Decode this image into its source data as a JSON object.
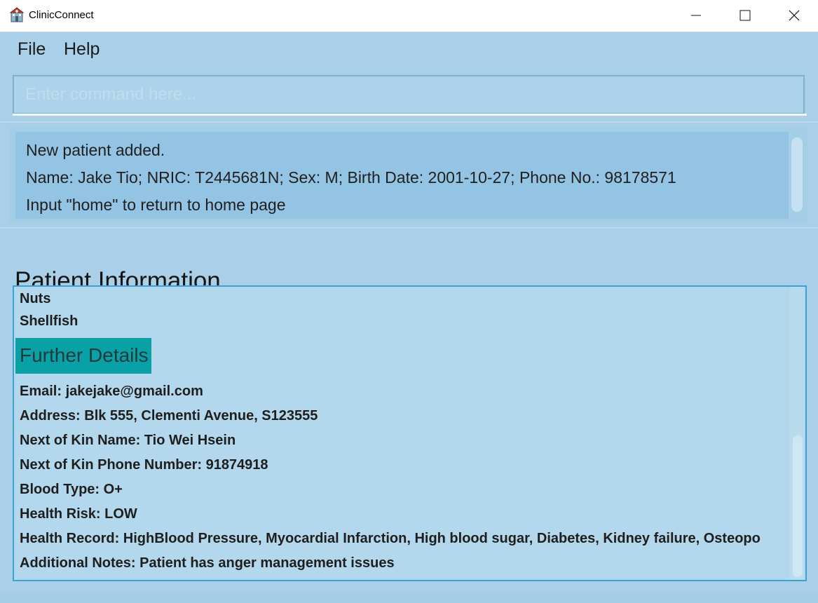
{
  "window": {
    "title": "ClinicConnect",
    "icon": "clinic-building-icon",
    "controls": [
      "minimize-icon",
      "maximize-icon",
      "close-icon"
    ]
  },
  "menu": {
    "file": "File",
    "help": "Help"
  },
  "command": {
    "placeholder": "Enter command here...",
    "value": ""
  },
  "result": {
    "lines": [
      "New patient added.",
      "Name: Jake Tio; NRIC: T2445681N; Sex: M; Birth Date: 2001-10-27; Phone No.: 98178571",
      "Input \"home\" to return to home page"
    ]
  },
  "patient_info": {
    "title": "Patient Information",
    "allergies": [
      "Nuts",
      "Shellfish"
    ],
    "further_details_title": "Further Details",
    "details": [
      "Email: jakejake@gmail.com",
      "Address: Blk 555, Clementi Avenue, S123555",
      "Next of Kin Name: Tio Wei Hsein",
      "Next of Kin Phone Number: 91874918",
      "Blood Type: O+",
      "Health Risk: LOW",
      "Health Record: HighBlood Pressure, Myocardial Infarction, High blood sugar, Diabetes, Kidney failure, Osteopo",
      "Additional Notes: Patient has anger management issues"
    ]
  },
  "colors": {
    "background": "#a9d0e8",
    "result_box": "#94c4e3",
    "section_header": "#0aa1a6",
    "panel_border": "#3aa3d4"
  }
}
